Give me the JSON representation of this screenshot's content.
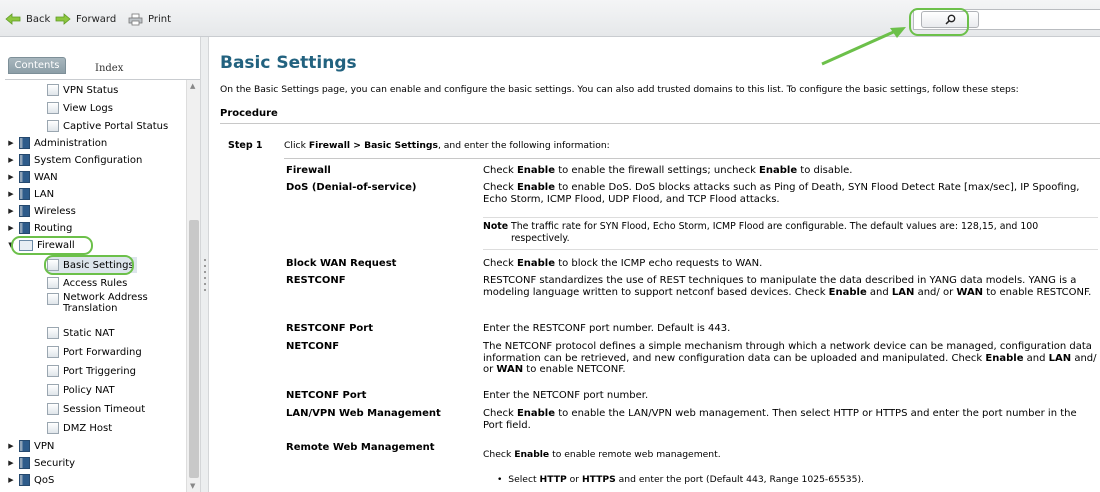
{
  "toolbar": {
    "back": "Back",
    "forward": "Forward",
    "print": "Print",
    "search_placeholder": ""
  },
  "sidebar": {
    "tab_contents": "Contents",
    "tab_index": "Index",
    "items": {
      "vpn_status": "VPN Status",
      "view_logs": "View Logs",
      "captive_portal_status": "Captive Portal Status",
      "administration": "Administration",
      "system_configuration": "System Configuration",
      "wan": "WAN",
      "lan": "LAN",
      "wireless": "Wireless",
      "routing": "Routing",
      "firewall": "Firewall",
      "basic_settings": "Basic Settings",
      "access_rules": "Access Rules",
      "nat": "Network Address Translation",
      "static_nat": "Static NAT",
      "port_forwarding": "Port Forwarding",
      "port_triggering": "Port Triggering",
      "policy_nat": "Policy NAT",
      "session_timeout": "Session Timeout",
      "dmz_host": "DMZ Host",
      "vpn": "VPN",
      "security": "Security",
      "qos": "QoS"
    }
  },
  "main": {
    "title": "Basic Settings",
    "intro": "On the Basic Settings page, you can enable and configure the basic settings. You can also add trusted domains to this list. To configure the basic settings, follow these steps:",
    "procedure": "Procedure",
    "step_label": "Step 1",
    "step_pre": "Click ",
    "step_bold": "Firewall > Basic Settings",
    "step_post": ", and enter the following information:",
    "rows": {
      "firewall": {
        "term": "Firewall",
        "d1": "Check ",
        "b1": "Enable",
        "d2": " to enable the firewall settings; uncheck ",
        "b2": "Enable",
        "d3": " to disable."
      },
      "dos": {
        "term": "DoS (Denial-of-service)",
        "d1": "Check ",
        "b1": "Enable",
        "d2": " to enable DoS. DoS blocks attacks such as Ping of Death, SYN Flood Detect Rate [max/sec], IP Spoofing, Echo Storm, ICMP Flood, UDP Flood, and TCP Flood attacks.",
        "note_label": "Note",
        "note_text": "The traffic rate for SYN Flood, Echo Storm, ICMP Flood are configurable. The default values are: 128,15, and 100 respectively."
      },
      "block_wan": {
        "term": "Block WAN Request",
        "d1": "Check ",
        "b1": "Enable",
        "d2": " to block the ICMP echo requests to WAN."
      },
      "restconf": {
        "term": "RESTCONF",
        "d1": "RESTCONF standardizes the use of REST techniques to manipulate the data described in YANG data models. YANG is a modeling language written to support netconf based devices. Check ",
        "b1": "Enable",
        "d2": " and ",
        "b2": "LAN",
        "d3": " and/ or ",
        "b3": "WAN",
        "d4": " to enable RESTCONF."
      },
      "restconf_port": {
        "term": "RESTCONF Port",
        "d1": "Enter the RESTCONF port number. Default is 443."
      },
      "netconf": {
        "term": "NETCONF",
        "d1": "The NETCONF protocol defines a simple mechanism through which a network device can be managed, configuration data information can be retrieved, and new configuration data can be uploaded and manipulated. Check ",
        "b1": "Enable",
        "d2": " and ",
        "b2": "LAN",
        "d3": " and/ or ",
        "b3": "WAN",
        "d4": " to enable NETCONF."
      },
      "netconf_port": {
        "term": "NETCONF Port",
        "d1": "Enter the NETCONF port number."
      },
      "lan_vpn": {
        "term": "LAN/VPN Web Management",
        "d1": "Check ",
        "b1": "Enable",
        "d2": " to enable the LAN/VPN web management. Then select HTTP or HTTPS and enter the port number in the Port field."
      },
      "remote": {
        "term": "Remote Web Management",
        "d1": "Check ",
        "b1": "Enable",
        "d2": " to enable remote web management.",
        "bullet_pre": "Select ",
        "bullet_b1": "HTTP",
        "bullet_mid": " or ",
        "bullet_b2": "HTTPS",
        "bullet_post": " and enter the port (Default 443, Range 1025-65535)."
      }
    }
  },
  "colors": {
    "title": "#22627f",
    "highlight_green": "#6cc04a",
    "arrow_icon": "#8dc63f"
  },
  "icons": {
    "back": "back-arrow-icon",
    "forward": "forward-arrow-icon",
    "print": "printer-icon",
    "search": "magnifier-icon"
  }
}
